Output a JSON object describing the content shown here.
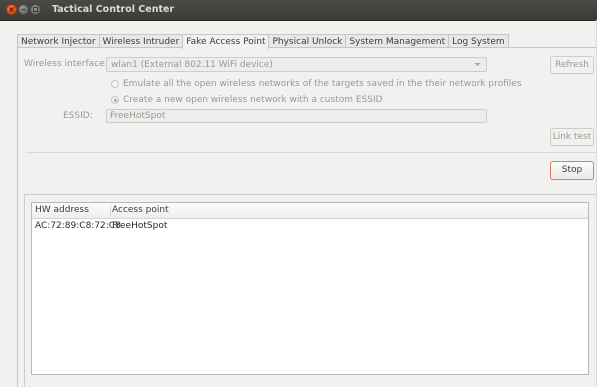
{
  "window": {
    "title": "Tactical Control Center"
  },
  "tabs": [
    {
      "label": "Network Injector"
    },
    {
      "label": "Wireless Intruder"
    },
    {
      "label": "Fake Access Point",
      "active": true
    },
    {
      "label": "Physical Unlock"
    },
    {
      "label": "System Management"
    },
    {
      "label": "Log System"
    }
  ],
  "form": {
    "interface_label": "Wireless interface:",
    "interface_value": "wlan1 (External 802.11 WiFi device)",
    "refresh_label": "Refresh",
    "option_emulate_label": "Emulate all the open wireless networks of the targets saved in the their network profiles",
    "option_create_label": "Create a new open wireless network with a custom ESSID",
    "selected_option": "create",
    "essid_label": "ESSID:",
    "essid_value": "FreeHotSpot",
    "link_test_label": "Link test",
    "stop_label": "Stop"
  },
  "clients_table": {
    "columns": [
      "HW address",
      "Access point"
    ],
    "rows": [
      [
        "AC:72:89:C8:72:C8",
        "FreeHotSpot"
      ]
    ]
  },
  "colors": {
    "titlebar": "#3c3b37",
    "close_button": "#df4a16",
    "accent_border": "#e37b54",
    "window_bg": "#f2f1f0"
  }
}
